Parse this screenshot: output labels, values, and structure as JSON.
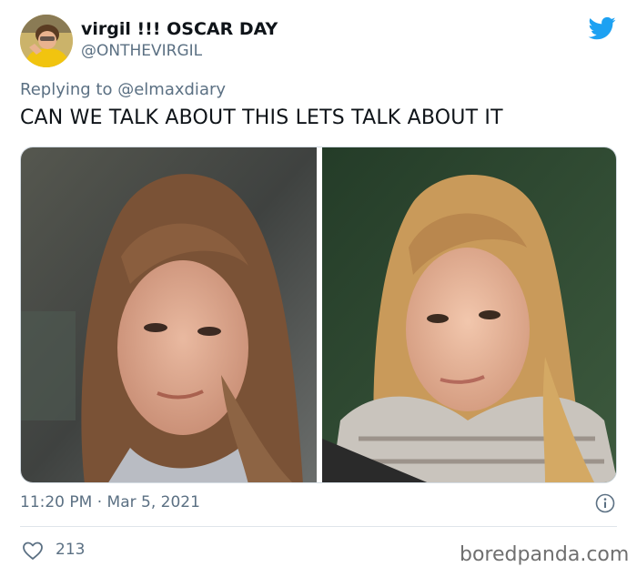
{
  "author": {
    "display_name": "virgil !!! OSCAR DAY",
    "handle": "@ONTHEVIRGIL"
  },
  "reply": {
    "prefix": "Replying to",
    "mention": "@elmaxdiary"
  },
  "tweet": {
    "text": "CAN WE TALK ABOUT THIS LETS TALK ABOUT IT",
    "timestamp": "11:20 PM · Mar 5, 2021",
    "like_count": "213"
  },
  "media": {
    "photo_count": 2
  },
  "icons": {
    "brand": "twitter-bird-icon",
    "info": "info-icon",
    "like": "heart-icon"
  },
  "colors": {
    "twitter_blue": "#1da1f2",
    "secondary_text": "#5b7083",
    "primary_text": "#0f1419"
  },
  "watermark": "boredpanda.com"
}
